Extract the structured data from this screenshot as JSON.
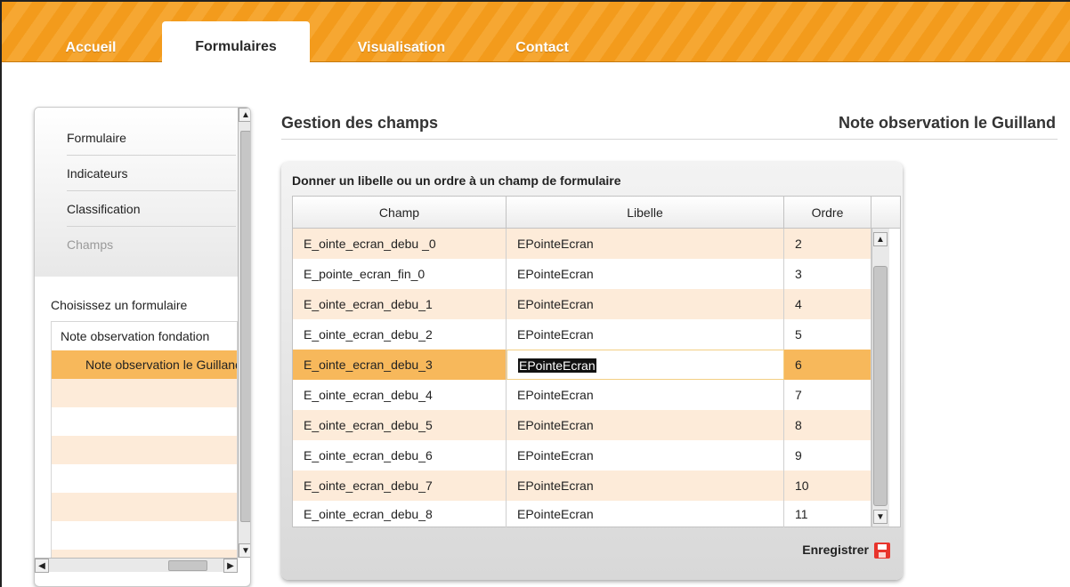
{
  "nav": {
    "tabs": [
      {
        "label": "Accueil",
        "active": false
      },
      {
        "label": "Formulaires",
        "active": true
      },
      {
        "label": "Visualisation",
        "active": false
      },
      {
        "label": "Contact",
        "active": false
      }
    ]
  },
  "sidebar": {
    "menu": [
      {
        "label": "Formulaire",
        "disabled": false
      },
      {
        "label": "Indicateurs",
        "disabled": false
      },
      {
        "label": "Classification",
        "disabled": false
      },
      {
        "label": "Champs",
        "disabled": true
      }
    ],
    "choose_label": "Choisissez un formulaire",
    "forms": [
      {
        "label": "Note observation fondation",
        "selected": false
      },
      {
        "label": "Note observation le Guilland",
        "selected": true
      }
    ]
  },
  "main": {
    "title": "Gestion des champs",
    "form_name": "Note observation le Guilland",
    "panel_title": "Donner un libelle ou un ordre à un champ de formulaire",
    "columns": [
      "Champ",
      "Libelle",
      "Ordre"
    ],
    "rows": [
      {
        "champ": "E_ointe_ecran_debu _0",
        "libelle": "EPointeEcran",
        "ordre": "2"
      },
      {
        "champ": "E_pointe_ecran_fin_0",
        "libelle": "EPointeEcran",
        "ordre": "3"
      },
      {
        "champ": "E_ointe_ecran_debu_1",
        "libelle": "EPointeEcran",
        "ordre": "4"
      },
      {
        "champ": "E_ointe_ecran_debu_2",
        "libelle": "EPointeEcran",
        "ordre": "5"
      },
      {
        "champ": "E_ointe_ecran_debu_3",
        "libelle": "EPointeEcran",
        "ordre": "6",
        "selected": true
      },
      {
        "champ": "E_ointe_ecran_debu_4",
        "libelle": "EPointeEcran",
        "ordre": "7"
      },
      {
        "champ": "E_ointe_ecran_debu_5",
        "libelle": "EPointeEcran",
        "ordre": "8"
      },
      {
        "champ": "E_ointe_ecran_debu_6",
        "libelle": "EPointeEcran",
        "ordre": "9"
      },
      {
        "champ": "E_ointe_ecran_debu_7",
        "libelle": "EPointeEcran",
        "ordre": "10"
      },
      {
        "champ": "E_ointe_ecran_debu_8",
        "libelle": "EPointeEcran",
        "ordre": "11"
      }
    ],
    "save_label": "Enregistrer"
  },
  "icons": {
    "save": "floppy-disk-icon",
    "scroll_up": "▲",
    "scroll_down": "▼",
    "scroll_left": "◀",
    "scroll_right": "▶"
  },
  "colors": {
    "nav_orange": "#f39b1c",
    "row_alt": "#fdebd9",
    "row_selected": "#f7b85b",
    "save_icon": "#e8342c"
  }
}
